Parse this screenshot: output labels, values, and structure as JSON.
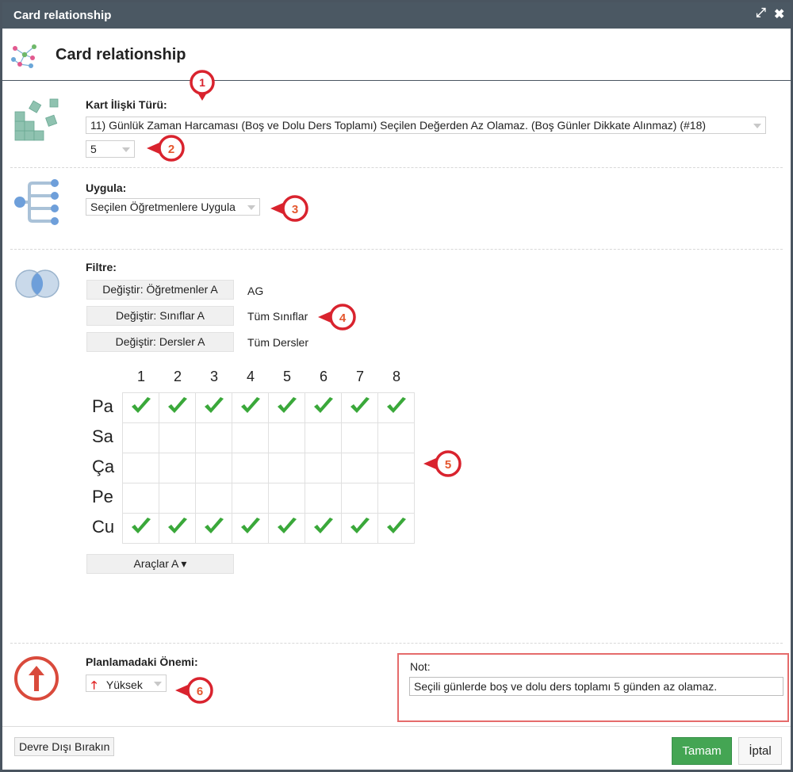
{
  "window": {
    "title": "Card relationship",
    "maximize_icon": "expand-icon",
    "close_icon": "close-icon"
  },
  "header": {
    "title": "Card relationship",
    "icon": "network-graph-icon"
  },
  "relation": {
    "label": "Kart İlişki Türü:",
    "type_value": "11) Günlük Zaman Harcaması (Boş ve Dolu Ders Toplamı) Seçilen Değerden Az Olamaz. (Boş Günler Dikkate Alınmaz) (#18)",
    "number_value": "5"
  },
  "apply": {
    "label": "Uygula:",
    "value": "Seçilen Öğretmenlere Uygula"
  },
  "filter": {
    "label": "Filtre:",
    "rows": [
      {
        "button": "Değiştir: Öğretmenler A",
        "value": "AG"
      },
      {
        "button": "Değiştir: Sınıflar A",
        "value": "Tüm Sınıflar"
      },
      {
        "button": "Değiştir: Dersler A",
        "value": "Tüm Dersler"
      }
    ]
  },
  "grid": {
    "columns": [
      "1",
      "2",
      "3",
      "4",
      "5",
      "6",
      "7",
      "8"
    ],
    "rows": [
      {
        "label": "Pa",
        "checked": [
          true,
          true,
          true,
          true,
          true,
          true,
          true,
          true
        ]
      },
      {
        "label": "Sa",
        "checked": [
          false,
          false,
          false,
          false,
          false,
          false,
          false,
          false
        ]
      },
      {
        "label": "Ça",
        "checked": [
          false,
          false,
          false,
          false,
          false,
          false,
          false,
          false
        ]
      },
      {
        "label": "Pe",
        "checked": [
          false,
          false,
          false,
          false,
          false,
          false,
          false,
          false
        ]
      },
      {
        "label": "Cu",
        "checked": [
          true,
          true,
          true,
          true,
          true,
          true,
          true,
          true
        ]
      }
    ],
    "tools_button": "Araçlar A ▾"
  },
  "importance": {
    "label": "Planlamadaki Önemi:",
    "value": "Yüksek",
    "icon": "arrow-up-icon"
  },
  "note": {
    "label": "Not:",
    "value": "Seçili günlerde boş ve dolu ders toplamı 5 günden az olamaz."
  },
  "footer": {
    "disable_button": "Devre Dışı Bırakın",
    "ok_button": "Tamam",
    "cancel_button": "İptal"
  },
  "badges": [
    "1",
    "2",
    "3",
    "4",
    "5",
    "6"
  ],
  "colors": {
    "titlebar": "#4b5863",
    "ok_green": "#44a553",
    "check_green": "#3aa83a",
    "badge_red": "#d9232e",
    "note_border": "#e56b6b",
    "importance_red": "#d94a3c"
  }
}
